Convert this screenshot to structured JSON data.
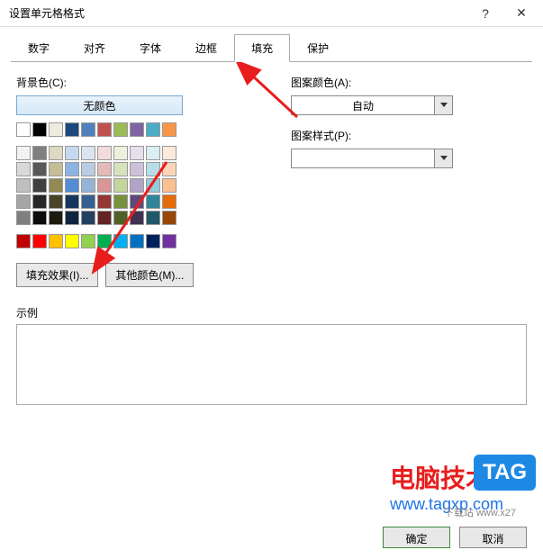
{
  "window": {
    "title": "设置单元格格式",
    "help_icon": "?",
    "close_icon": "✕"
  },
  "tabs": [
    "数字",
    "对齐",
    "字体",
    "边框",
    "填充",
    "保护"
  ],
  "active_tab": "填充",
  "left_panel": {
    "bg_color_label": "背景色(C):",
    "no_color_label": "无颜色",
    "fill_effects_btn": "填充效果(I)...",
    "more_colors_btn": "其他颜色(M)..."
  },
  "right_panel": {
    "pattern_color_label": "图案颜色(A):",
    "pattern_color_value": "自动",
    "pattern_style_label": "图案样式(P):",
    "pattern_style_value": ""
  },
  "example_label": "示例",
  "footer": {
    "ok": "确定",
    "cancel": "取消"
  },
  "swatches": {
    "row1": [
      "#ffffff",
      "#000000",
      "#eeece1",
      "#1f497d",
      "#4f81bd",
      "#c0504d",
      "#9bbb59",
      "#8064a2",
      "#4bacc6",
      "#f79646"
    ],
    "themeRows": [
      [
        "#f2f2f2",
        "#7f7f7f",
        "#ddd9c3",
        "#c6d9f0",
        "#dbe5f1",
        "#f2dcdb",
        "#ebf1dd",
        "#e5e0ec",
        "#dbeef3",
        "#fdeada"
      ],
      [
        "#d8d8d8",
        "#595959",
        "#c4bd97",
        "#8db3e2",
        "#b8cce4",
        "#e5b9b7",
        "#d7e3bc",
        "#ccc1d9",
        "#b7dde8",
        "#fbd5b5"
      ],
      [
        "#bfbfbf",
        "#3f3f3f",
        "#938953",
        "#548dd4",
        "#95b3d7",
        "#d99694",
        "#c3d69b",
        "#b2a2c7",
        "#92cddc",
        "#fac08f"
      ],
      [
        "#a5a5a5",
        "#262626",
        "#494429",
        "#17365d",
        "#366092",
        "#953734",
        "#76923c",
        "#5f497a",
        "#31859b",
        "#e36c09"
      ],
      [
        "#7f7f7f",
        "#0c0c0c",
        "#1d1b10",
        "#0f243e",
        "#244061",
        "#632423",
        "#4f6128",
        "#3f3151",
        "#205867",
        "#974806"
      ]
    ],
    "standard": [
      "#c00000",
      "#ff0000",
      "#ffc000",
      "#ffff00",
      "#92d050",
      "#00b050",
      "#00b0f0",
      "#0070c0",
      "#002060",
      "#7030a0"
    ]
  },
  "watermark": {
    "cn": "电脑技术网",
    "url": "www.tagxp.com",
    "tag": "TAG",
    "sub": "下载站 www.x27"
  }
}
